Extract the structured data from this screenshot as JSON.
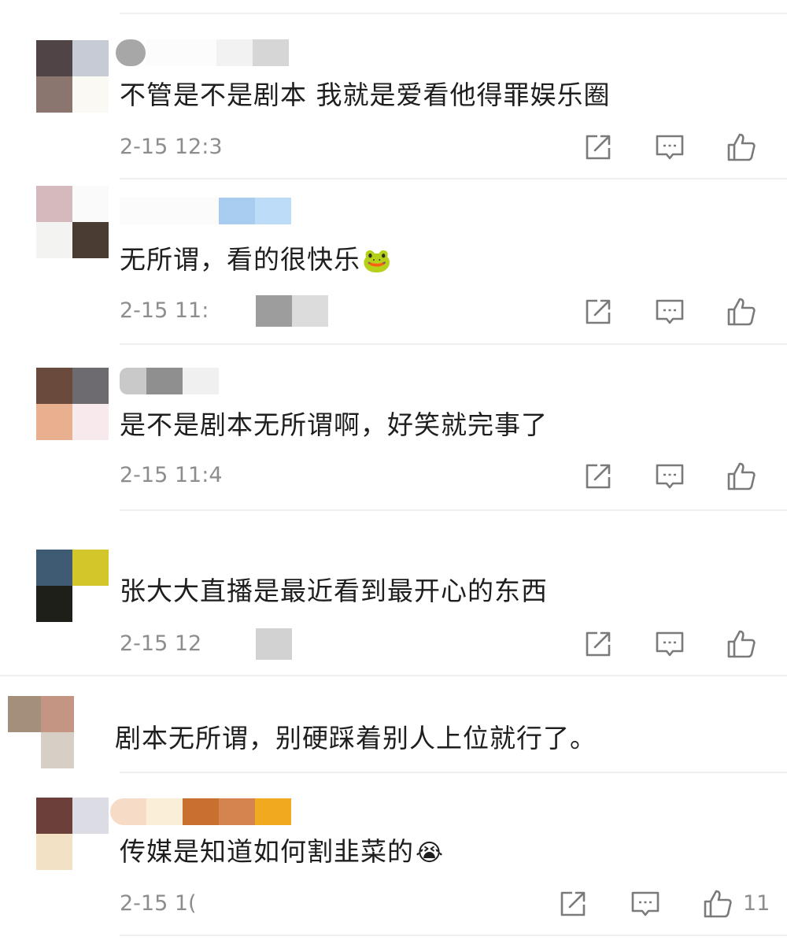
{
  "comments": [
    {
      "text": "不管是不是剧本  我就是爱看他得罪娱乐圈",
      "time": "2-15 12:3",
      "avatar_colors": [
        "#504446",
        "#c7cbd6",
        "#8a766f",
        "#faf9f4"
      ],
      "name_colors": [
        "#a7a7a7",
        "#f2f2f2",
        "#ffffff",
        "#f4f4f4",
        "#d6d6d6"
      ]
    },
    {
      "text": "无所谓，看的很快乐",
      "emoji": "🐸",
      "time": "2-15 11:",
      "avatar_colors": [
        "#d4b9bd",
        "#fafafa",
        "#f3f3f1",
        "#4a3c33"
      ],
      "name_colors": [
        "#f8f8f8",
        "#ffffff",
        "#a8cdf0",
        "#bcdcf8"
      ]
    },
    {
      "text": "是不是剧本无所谓啊，好笑就完事了",
      "time": "2-15 11:4",
      "avatar_colors": [
        "#6b4a3e",
        "#6d6b70",
        "#e8b08f",
        "#f8eaec"
      ],
      "name_colors": [
        "#c9c9c9",
        "#8f8f8f",
        "#f0f0f0"
      ]
    },
    {
      "text": "张大大直播是最近看到最开心的东西",
      "time": "2-15 12",
      "avatar_colors": [
        "#3f5a73",
        "#d2c62b",
        "#1f1f1a",
        "#ffffff"
      ],
      "name_colors": [
        "#ffffff"
      ]
    },
    {
      "text": "剧本无所谓，别硬踩着别人上位就行了。",
      "avatar_colors": [
        "#a48f7a",
        "#c59584",
        "#d7cfc6",
        "#ffffff"
      ],
      "name_colors": [
        "#ffffff"
      ]
    },
    {
      "text": "传媒是知道如何割韭菜的",
      "emoji": "😭",
      "time": "2-15 1(",
      "likes": "11",
      "avatar_colors": [
        "#6d3f3a",
        "#dcdde4",
        "#f2e1c5",
        "#ffffff"
      ],
      "name_colors": [
        "#f6dcc6",
        "#faeed9",
        "#c8702f",
        "#d58450",
        "#f1a91f"
      ]
    }
  ],
  "icons": {
    "share": "share-icon",
    "reply": "comment-icon",
    "like": "thumbs-up-icon"
  },
  "colors": {
    "text": "#1e1e1e",
    "meta": "#8d8d8d",
    "icon": "#7a7a7a",
    "divider": "#f0f0f0"
  }
}
